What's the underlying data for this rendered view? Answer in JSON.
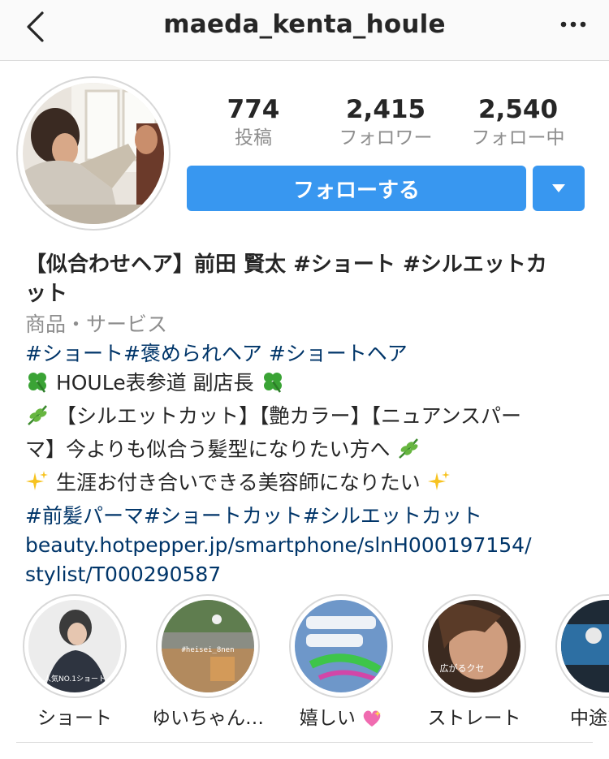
{
  "header": {
    "username": "maeda_kenta_houle",
    "back_icon": "chevron-left-icon",
    "more_icon": "more-dots-icon"
  },
  "stats": [
    {
      "value": "774",
      "label": "投稿"
    },
    {
      "value": "2,415",
      "label": "フォロワー"
    },
    {
      "value": "2,540",
      "label": "フォロー中"
    }
  ],
  "actions": {
    "follow_label": "フォローする",
    "dropdown_icon": "caret-down-icon"
  },
  "colors": {
    "accent": "#3897f0",
    "link": "#003569",
    "muted": "#8e8e8e",
    "text": "#262626"
  },
  "bio": {
    "name_line1": "【似合わせヘア】前田 賢太 #ショート #シルエットカ",
    "name_line2": "ット",
    "category": "商品・サービス",
    "hashtags1": "#ショート#褒められヘア #ショートヘア",
    "line_shop": "HOULe表参道 副店長",
    "line_menu1": "【シルエットカット】【艶カラー】【ニュアンスパー",
    "line_menu2": "マ】今よりも似合う髪型になりたい方へ",
    "line_dream": "生涯お付き合いできる美容師になりたい",
    "hashtags2": "#前髪パーマ#ショートカット#シルエットカット",
    "link_line1": "beauty.hotpepper.jp/smartphone/slnH000197154/",
    "link_line2": "stylist/T000290587"
  },
  "highlights": [
    {
      "label": "ショート",
      "overlay": "人気NO.1ショート"
    },
    {
      "label": "ゆいちゃん…",
      "overlay": "#heisei_8nen"
    },
    {
      "label": "嬉しい",
      "overlay": ""
    },
    {
      "label": "ストレート",
      "overlay": "広がるクセ"
    },
    {
      "label": "中途、美",
      "overlay": ""
    }
  ]
}
